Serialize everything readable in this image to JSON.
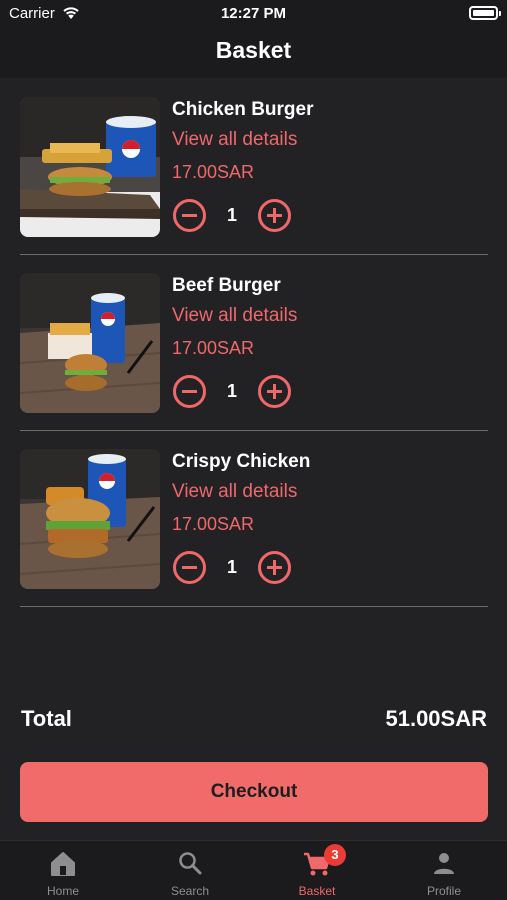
{
  "status_bar": {
    "carrier": "Carrier",
    "time": "12:27 PM"
  },
  "header": {
    "title": "Basket"
  },
  "items": [
    {
      "name": "Chicken Burger",
      "details_link": "View all details",
      "price": "17.00SAR",
      "quantity": "1"
    },
    {
      "name": "Beef Burger",
      "details_link": "View all details",
      "price": "17.00SAR",
      "quantity": "1"
    },
    {
      "name": "Crispy Chicken",
      "details_link": "View all details",
      "price": "17.00SAR",
      "quantity": "1"
    }
  ],
  "summary": {
    "total_label": "Total",
    "total_value": "51.00SAR"
  },
  "checkout": {
    "label": "Checkout"
  },
  "tabs": [
    {
      "label": "Home",
      "icon": "home-icon"
    },
    {
      "label": "Search",
      "icon": "search-icon"
    },
    {
      "label": "Basket",
      "icon": "cart-icon",
      "badge": "3"
    },
    {
      "label": "Profile",
      "icon": "person-icon"
    }
  ],
  "colors": {
    "accent": "#f0686a",
    "background": "#222225",
    "bar": "#1b1b1d",
    "badge": "#ea3b35"
  }
}
